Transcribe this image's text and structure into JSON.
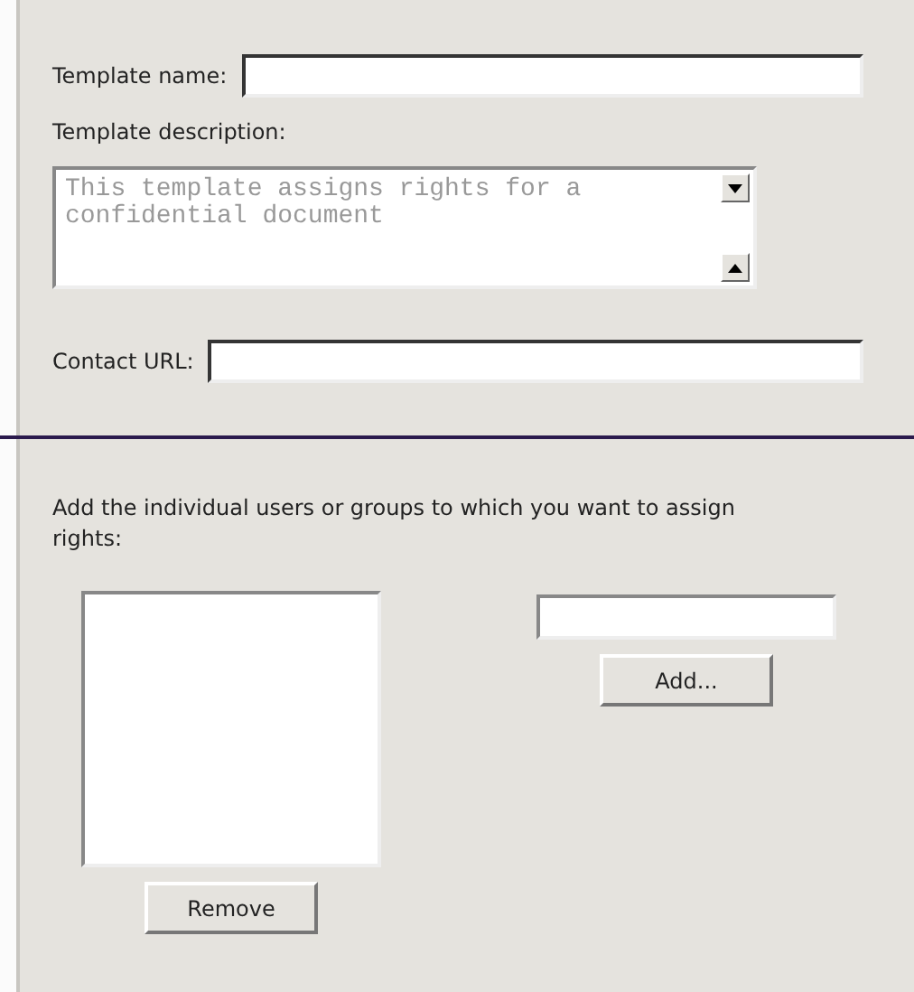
{
  "template_name": {
    "label": "Template name:"
  },
  "template_description": {
    "label": "Template description:",
    "placeholder": "This template assigns rights for a confidential document"
  },
  "contact_url": {
    "label": "Contact URL:"
  },
  "users": {
    "instruction": "Add the individual users or groups to which you want to assign rights:",
    "remove_button": "Remove",
    "add_button": "Add..."
  }
}
